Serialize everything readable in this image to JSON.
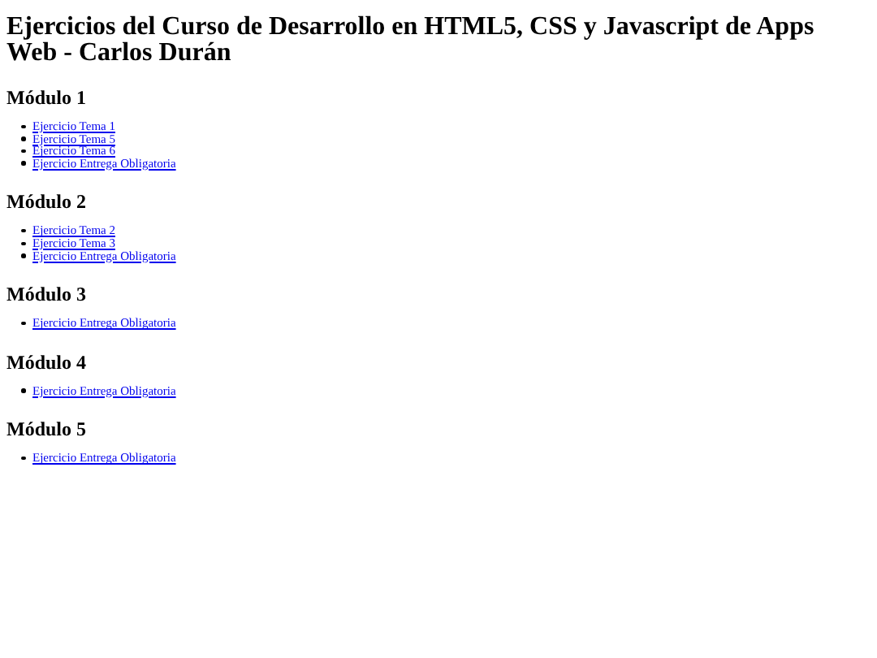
{
  "title": "Ejercicios del Curso de Desarrollo en HTML5, CSS y Javascript de Apps Web - Carlos Durán",
  "modules": [
    {
      "heading": "Módulo 1",
      "links": [
        "Ejercicio Tema 1",
        "Ejercicio Tema 5",
        "Ejercicio Tema 6",
        "Ejercicio Entrega Obligatoria"
      ]
    },
    {
      "heading": "Módulo 2",
      "links": [
        "Ejercicio Tema 2",
        "Ejercicio Tema 3",
        "Ejercicio Entrega Obligatoria"
      ]
    },
    {
      "heading": "Módulo 3",
      "links": [
        "Ejercicio Entrega Obligatoria"
      ]
    },
    {
      "heading": "Módulo 4",
      "links": [
        "Ejercicio Entrega Obligatoria"
      ]
    },
    {
      "heading": "Módulo 5",
      "links": [
        "Ejercicio Entrega Obligatoria"
      ]
    }
  ]
}
